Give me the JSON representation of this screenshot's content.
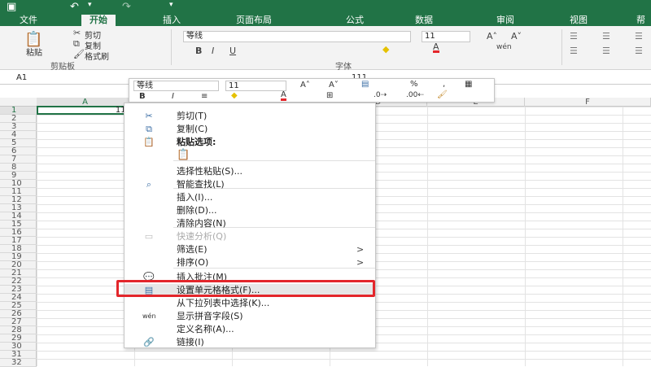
{
  "ribbon_tabs": [
    "文件",
    "开始",
    "插入",
    "页面布局",
    "公式",
    "数据",
    "审阅",
    "视图",
    "帮"
  ],
  "quick_access": {
    "undo": "↶",
    "redo": "↷",
    "more": "▾"
  },
  "clipboard": {
    "cut": "剪切",
    "copy": "复制",
    "format_painter": "格式刷",
    "paste": "粘贴",
    "group_label": "剪贴板"
  },
  "font": {
    "name": "等线",
    "size": "11",
    "group_label": "字体",
    "bold": "B",
    "italic": "I",
    "underline": "U",
    "pinyin": "wén"
  },
  "formula_bar": {
    "name_box": "A1",
    "value": "111"
  },
  "columns": [
    "A",
    "B",
    "C",
    "D",
    "E",
    "F"
  ],
  "rows": [
    "1",
    "2",
    "3",
    "4",
    "5",
    "6",
    "7",
    "8",
    "9",
    "10",
    "11",
    "12",
    "13",
    "14",
    "15",
    "16",
    "17",
    "18",
    "19",
    "20",
    "21",
    "22",
    "23",
    "24",
    "25",
    "26",
    "27",
    "28",
    "29",
    "30",
    "31",
    "32"
  ],
  "cell_a1": "111",
  "mini_toolbar": {
    "font": "等线",
    "size": "11",
    "bold": "B",
    "italic": "I",
    "percent": "%",
    "comma": ","
  },
  "context_menu": [
    {
      "label": "剪切(T)",
      "icon": "scissors-icon"
    },
    {
      "label": "复制(C)",
      "icon": "copy-icon"
    },
    {
      "label": "粘贴选项:",
      "icon": "paste-icon"
    },
    {
      "label": "选择性粘贴(S)...",
      "icon": ""
    },
    {
      "label": "智能查找(L)",
      "icon": "search-icon"
    },
    {
      "label": "插入(I)...",
      "icon": ""
    },
    {
      "label": "删除(D)...",
      "icon": ""
    },
    {
      "label": "清除内容(N)",
      "icon": ""
    },
    {
      "label": "快速分析(Q)",
      "icon": "quick-analysis-icon",
      "disabled": true
    },
    {
      "label": "筛选(E)",
      "icon": "",
      "submenu": true
    },
    {
      "label": "排序(O)",
      "icon": "",
      "submenu": true
    },
    {
      "label": "插入批注(M)",
      "icon": "comment-icon"
    },
    {
      "label": "设置单元格格式(F)...",
      "icon": "format-cells-icon",
      "highlighted": true
    },
    {
      "label": "从下拉列表中选择(K)...",
      "icon": ""
    },
    {
      "label": "显示拼音字段(S)",
      "icon": "pinyin-icon"
    },
    {
      "label": "定义名称(A)...",
      "icon": ""
    },
    {
      "label": "链接(I)",
      "icon": "link-icon"
    }
  ],
  "colors": {
    "excel_green": "#217346",
    "highlight_red": "#e3262b"
  }
}
